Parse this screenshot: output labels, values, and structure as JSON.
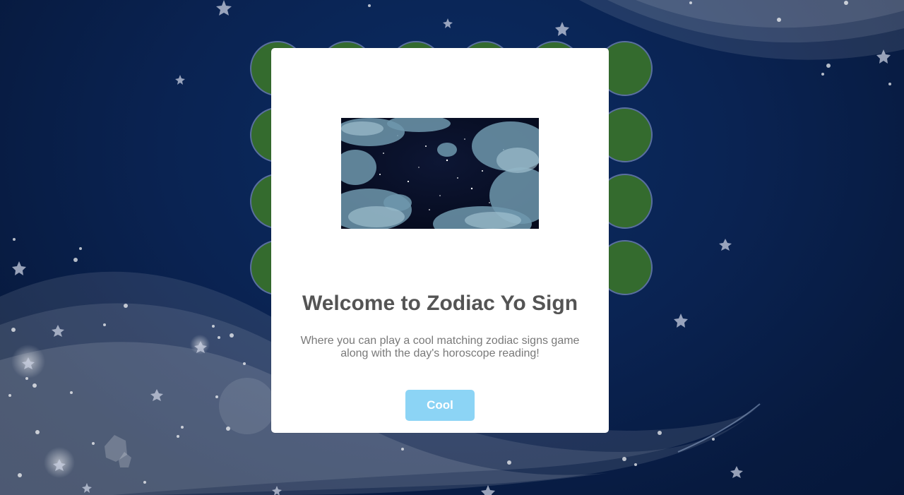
{
  "modal": {
    "title": "Welcome to Zodiac Yo Sign",
    "text_line1": "Where you can play a cool matching zodiac signs game",
    "text_line2": "along with the day's horoscope reading!",
    "confirm_label": "Cool",
    "confirm_color": "#8cd4f5"
  },
  "board": {
    "tile_color": "#346b2e",
    "rows": 4,
    "columns": 6
  },
  "background": {
    "icon": "starry-night-background",
    "base_color": "#0a2352"
  }
}
